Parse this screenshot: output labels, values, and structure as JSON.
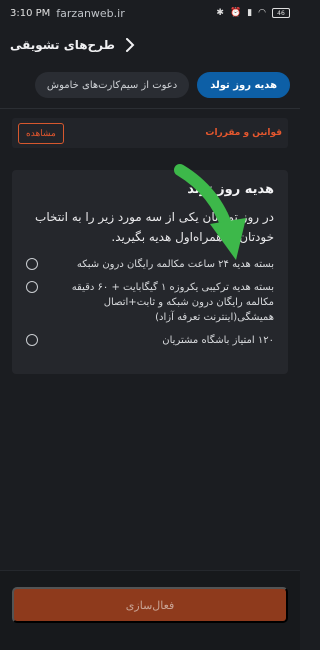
{
  "status_bar": {
    "time": "3:10 PM",
    "watermark": "farzanweb.ir",
    "battery": "46"
  },
  "header": {
    "title": "طرح‌های تشویقی"
  },
  "tabs": [
    {
      "label": "هدیه روز تولد",
      "active": true
    },
    {
      "label": "دعوت از سیم‌کارت‌های خاموش",
      "active": false
    }
  ],
  "rules": {
    "label": "قوانین و مقررات",
    "button": "مشاهده"
  },
  "gift": {
    "title": "هدیه روز تولد",
    "description": "در روز تولدتان یکی از سه مورد زیر را به انتخاب خودتان از همراه‌اول هدیه بگیرید.",
    "options": [
      "بسته هدیه ۲۴ ساعت مکالمه رایگان درون شبکه",
      "بسته هدیه ترکیبی یکروزه ۱ گیگابایت + ۶۰ دقیقه مکالمه رایگان درون شبکه و ثابت+اتصال همیشگی(اینترنت تعرفه آزاد)",
      "۱۲۰ امتیاز باشگاه مشتریان"
    ]
  },
  "footer": {
    "activate_label": "فعال‌سازی"
  },
  "colors": {
    "accent_orange": "#e4572e",
    "tab_blue": "#0d5fa6",
    "arrow_green": "#3db84a"
  }
}
